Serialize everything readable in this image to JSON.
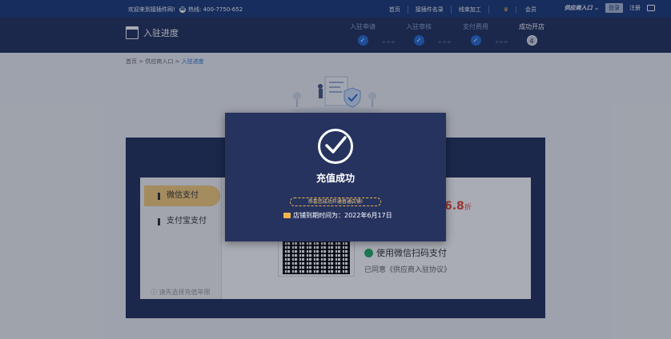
{
  "topbar": {
    "welcome": "欢迎来到接插件网!",
    "hotline": "热线: 400-7750-652",
    "nav": [
      "首页",
      "接插件名录",
      "线束加工",
      "会员"
    ],
    "supplier_entry": "供应商入口",
    "login": "登录",
    "register": "注册"
  },
  "header": {
    "title": "入驻进度",
    "steps": [
      {
        "label": "入驻申请",
        "marker": "✓"
      },
      {
        "label": "入驻审核",
        "marker": "✓"
      },
      {
        "label": "支付费用",
        "marker": "✓"
      },
      {
        "label": "成功开店",
        "marker": "4"
      }
    ]
  },
  "breadcrumb": {
    "home": "首页",
    "supplier": "供应商入口",
    "current": "入驻进度",
    "separator": ">"
  },
  "payment": {
    "methods": [
      "微信支付",
      "支付宝支付"
    ],
    "hint": "请先选择充值年限",
    "discount_value": "6.8",
    "discount_unit": "折",
    "scan_label": "使用微信扫码支付",
    "agreement": "已同意《供应商入驻协议》"
  },
  "modal": {
    "title": "充值成功",
    "notice": "恭喜您成功开通普通店铺!",
    "expire": "店铺到期时间为：2022年6月17日"
  },
  "colors": {
    "brand_dark": "#26335f",
    "topbar": "#1f3c7a",
    "accent_gold": "#f7ce7d",
    "step_blue": "#2a6fd6",
    "discount_red": "#e64a3b"
  }
}
